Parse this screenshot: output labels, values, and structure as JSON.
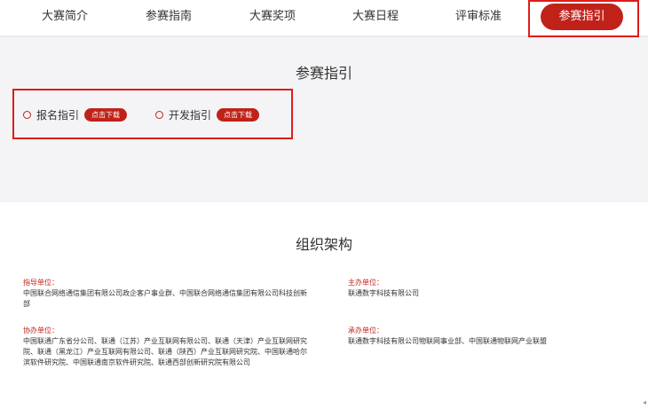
{
  "nav": {
    "items": [
      "大赛简介",
      "参赛指南",
      "大赛奖项",
      "大赛日程",
      "评审标准"
    ],
    "active": "参赛指引"
  },
  "guide": {
    "title": "参赛指引",
    "items": [
      {
        "label": "报名指引",
        "button": "点击下载"
      },
      {
        "label": "开发指引",
        "button": "点击下载"
      }
    ]
  },
  "org": {
    "title": "组织架构",
    "guide_unit": {
      "label": "指导单位：",
      "text": "中国联合网络通信集团有限公司政企客户事业群、中国联合网络通信集团有限公司科技创新部"
    },
    "host_unit": {
      "label": "主办单位：",
      "text": "联通数字科技有限公司"
    },
    "co_unit": {
      "label": "协办单位：",
      "text": "中国联通广东省分公司、联通（江苏）产业互联网有限公司、联通（天津）产业互联网研究院、联通（黑龙江）产业互联网有限公司、联通（陕西）产业互联网研究院、中国联通哈尔滨软件研究院、中国联通南京软件研究院、联通西部创新研究院有限公司"
    },
    "organizer_unit": {
      "label": "承办单位：",
      "text": "联通数字科技有限公司物联网事业部、中国联通物联网产业联盟"
    }
  },
  "colors": {
    "accent": "#c0221a",
    "highlight": "#e01b1b",
    "section_bg": "#f4f4f6"
  }
}
